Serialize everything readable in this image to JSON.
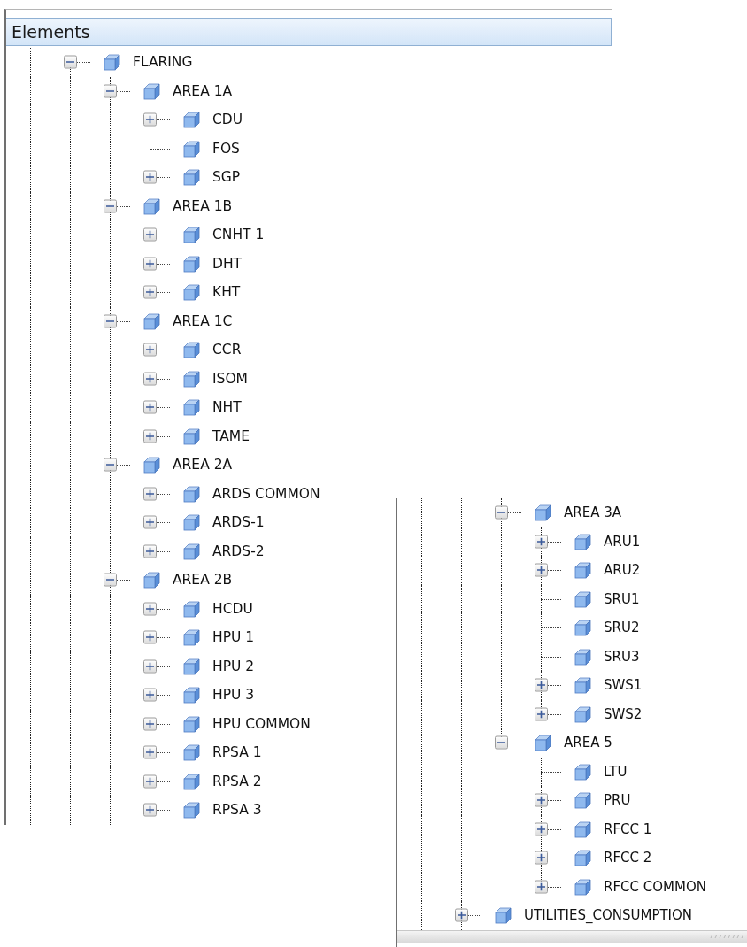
{
  "panels": [
    {
      "title": "Elements",
      "tree": [
        {
          "label": "FLARING",
          "kind": "branch",
          "expanded": true,
          "children": [
            {
              "label": "AREA 1A",
              "kind": "branch",
              "expanded": true,
              "children": [
                {
                  "label": "CDU",
                  "kind": "branch",
                  "expanded": false
                },
                {
                  "label": "FOS",
                  "kind": "leaf"
                },
                {
                  "label": "SGP",
                  "kind": "branch",
                  "expanded": false
                }
              ]
            },
            {
              "label": "AREA 1B",
              "kind": "branch",
              "expanded": true,
              "children": [
                {
                  "label": "CNHT 1",
                  "kind": "branch",
                  "expanded": false
                },
                {
                  "label": "DHT",
                  "kind": "branch",
                  "expanded": false
                },
                {
                  "label": "KHT",
                  "kind": "branch",
                  "expanded": false
                }
              ]
            },
            {
              "label": "AREA 1C",
              "kind": "branch",
              "expanded": true,
              "children": [
                {
                  "label": "CCR",
                  "kind": "branch",
                  "expanded": false
                },
                {
                  "label": "ISOM",
                  "kind": "branch",
                  "expanded": false
                },
                {
                  "label": "NHT",
                  "kind": "branch",
                  "expanded": false
                },
                {
                  "label": "TAME",
                  "kind": "branch",
                  "expanded": false
                }
              ]
            },
            {
              "label": "AREA 2A",
              "kind": "branch",
              "expanded": true,
              "children": [
                {
                  "label": "ARDS COMMON",
                  "kind": "branch",
                  "expanded": false
                },
                {
                  "label": "ARDS-1",
                  "kind": "branch",
                  "expanded": false
                },
                {
                  "label": "ARDS-2",
                  "kind": "branch",
                  "expanded": false
                }
              ]
            },
            {
              "label": "AREA 2B",
              "kind": "branch",
              "expanded": true,
              "children": [
                {
                  "label": "HCDU",
                  "kind": "branch",
                  "expanded": false
                },
                {
                  "label": "HPU 1",
                  "kind": "branch",
                  "expanded": false
                },
                {
                  "label": "HPU 2",
                  "kind": "branch",
                  "expanded": false
                },
                {
                  "label": "HPU 3",
                  "kind": "branch",
                  "expanded": false
                },
                {
                  "label": "HPU COMMON",
                  "kind": "branch",
                  "expanded": false
                },
                {
                  "label": "RPSA 1",
                  "kind": "branch",
                  "expanded": false
                },
                {
                  "label": "RPSA 2",
                  "kind": "branch",
                  "expanded": false
                },
                {
                  "label": "RPSA 3",
                  "kind": "branch",
                  "expanded": false
                }
              ]
            }
          ]
        }
      ]
    },
    {
      "tree": [
        {
          "children": [
            {
              "label": "AREA 3A",
              "kind": "branch",
              "expanded": true,
              "children": [
                {
                  "label": "ARU1",
                  "kind": "branch",
                  "expanded": false
                },
                {
                  "label": "ARU2",
                  "kind": "branch",
                  "expanded": false
                },
                {
                  "label": "SRU1",
                  "kind": "leaf"
                },
                {
                  "label": "SRU2",
                  "kind": "leaf"
                },
                {
                  "label": "SRU3",
                  "kind": "leaf"
                },
                {
                  "label": "SWS1",
                  "kind": "branch",
                  "expanded": false
                },
                {
                  "label": "SWS2",
                  "kind": "branch",
                  "expanded": false
                }
              ]
            },
            {
              "label": "AREA 5",
              "kind": "branch",
              "expanded": true,
              "children": [
                {
                  "label": "LTU",
                  "kind": "leaf"
                },
                {
                  "label": "PRU",
                  "kind": "branch",
                  "expanded": false
                },
                {
                  "label": "RFCC 1",
                  "kind": "branch",
                  "expanded": false
                },
                {
                  "label": "RFCC 2",
                  "kind": "branch",
                  "expanded": false
                },
                {
                  "label": "RFCC COMMON",
                  "kind": "branch",
                  "expanded": false
                }
              ]
            }
          ]
        },
        {
          "label": "UTILITIES_CONSUMPTION",
          "kind": "branch",
          "expanded": false
        }
      ]
    }
  ]
}
